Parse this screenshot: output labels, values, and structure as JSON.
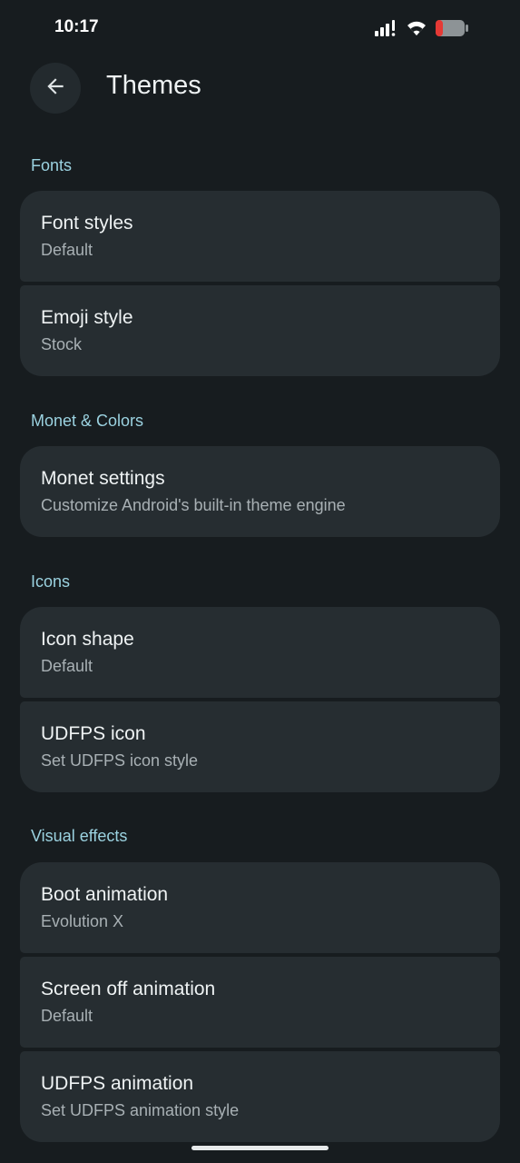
{
  "status_bar": {
    "time": "10:17"
  },
  "header": {
    "title": "Themes",
    "back_icon": "arrow-left-icon"
  },
  "sections": [
    {
      "header": "Fonts",
      "items": [
        {
          "title": "Font styles",
          "subtitle": "Default"
        },
        {
          "title": "Emoji style",
          "subtitle": "Stock"
        }
      ]
    },
    {
      "header": "Monet & Colors",
      "items": [
        {
          "title": "Monet settings",
          "subtitle": "Customize Android's built-in theme engine"
        }
      ]
    },
    {
      "header": "Icons",
      "items": [
        {
          "title": "Icon shape",
          "subtitle": "Default"
        },
        {
          "title": "UDFPS icon",
          "subtitle": "Set UDFPS icon style"
        }
      ]
    },
    {
      "header": "Visual effects",
      "items": [
        {
          "title": "Boot animation",
          "subtitle": "Evolution X"
        },
        {
          "title": "Screen off animation",
          "subtitle": "Default"
        },
        {
          "title": "UDFPS animation",
          "subtitle": "Set UDFPS animation style"
        }
      ]
    }
  ],
  "colors": {
    "background": "#171c1f",
    "card": "#262d31",
    "section_header": "#9bd2e0",
    "battery_low": "#e53935"
  }
}
